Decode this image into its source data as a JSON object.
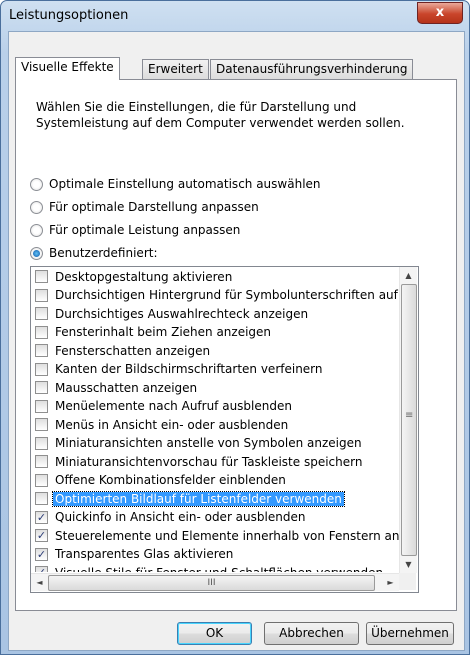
{
  "window": {
    "title": "Leistungsoptionen",
    "close_glyph": "x"
  },
  "tabs": [
    {
      "label": "Visuelle Effekte"
    },
    {
      "label": "Erweitert"
    },
    {
      "label": "Datenausführungsverhinderung"
    }
  ],
  "description": "Wählen Sie die Einstellungen, die für Darstellung und Systemleistung auf dem Computer verwendet werden sollen.",
  "radios": [
    {
      "label": "Optimale Einstellung automatisch auswählen",
      "checked": false
    },
    {
      "label": "Für optimale Darstellung anpassen",
      "checked": false
    },
    {
      "label": "Für optimale Leistung anpassen",
      "checked": false
    },
    {
      "label": "Benutzerdefiniert:",
      "checked": true
    }
  ],
  "effects": [
    {
      "label": "Desktopgestaltung aktivieren",
      "checked": false
    },
    {
      "label": "Durchsichtigen Hintergrund für Symbolunterschriften auf d",
      "checked": false
    },
    {
      "label": "Durchsichtiges Auswahlrechteck anzeigen",
      "checked": false
    },
    {
      "label": "Fensterinhalt beim Ziehen anzeigen",
      "checked": false
    },
    {
      "label": "Fensterschatten anzeigen",
      "checked": false
    },
    {
      "label": "Kanten der Bildschirmschriftarten verfeinern",
      "checked": false
    },
    {
      "label": "Mausschatten anzeigen",
      "checked": false
    },
    {
      "label": "Menüelemente nach Aufruf ausblenden",
      "checked": false
    },
    {
      "label": "Menüs in Ansicht ein- oder ausblenden",
      "checked": false
    },
    {
      "label": "Miniaturansichten anstelle von Symbolen anzeigen",
      "checked": false
    },
    {
      "label": "Miniaturansichtenvorschau für Taskleiste speichern",
      "checked": false
    },
    {
      "label": "Offene Kombinationsfelder einblenden",
      "checked": false
    },
    {
      "label": "Optimierten Bildlauf für Listenfelder verwenden",
      "checked": false,
      "selected": true
    },
    {
      "label": "Quickinfo in Ansicht ein- oder ausblenden",
      "checked": true
    },
    {
      "label": "Steuerelemente und Elemente innerhalb von Fenstern anir",
      "checked": true
    },
    {
      "label": "Transparentes Glas aktivieren",
      "checked": true
    },
    {
      "label": "Visuelle Stile für Fenster und Schaltflächen verwenden",
      "checked": true
    }
  ],
  "scrollbars": {
    "up": "▲",
    "down": "▼",
    "left": "◄",
    "right": "►",
    "vgrip": "≡",
    "hgrip": "III"
  },
  "buttons": {
    "ok": "OK",
    "cancel": "Abbrechen",
    "apply": "Übernehmen"
  },
  "colors": {
    "selection": "#3399ff",
    "title_close": "#c9452b"
  }
}
